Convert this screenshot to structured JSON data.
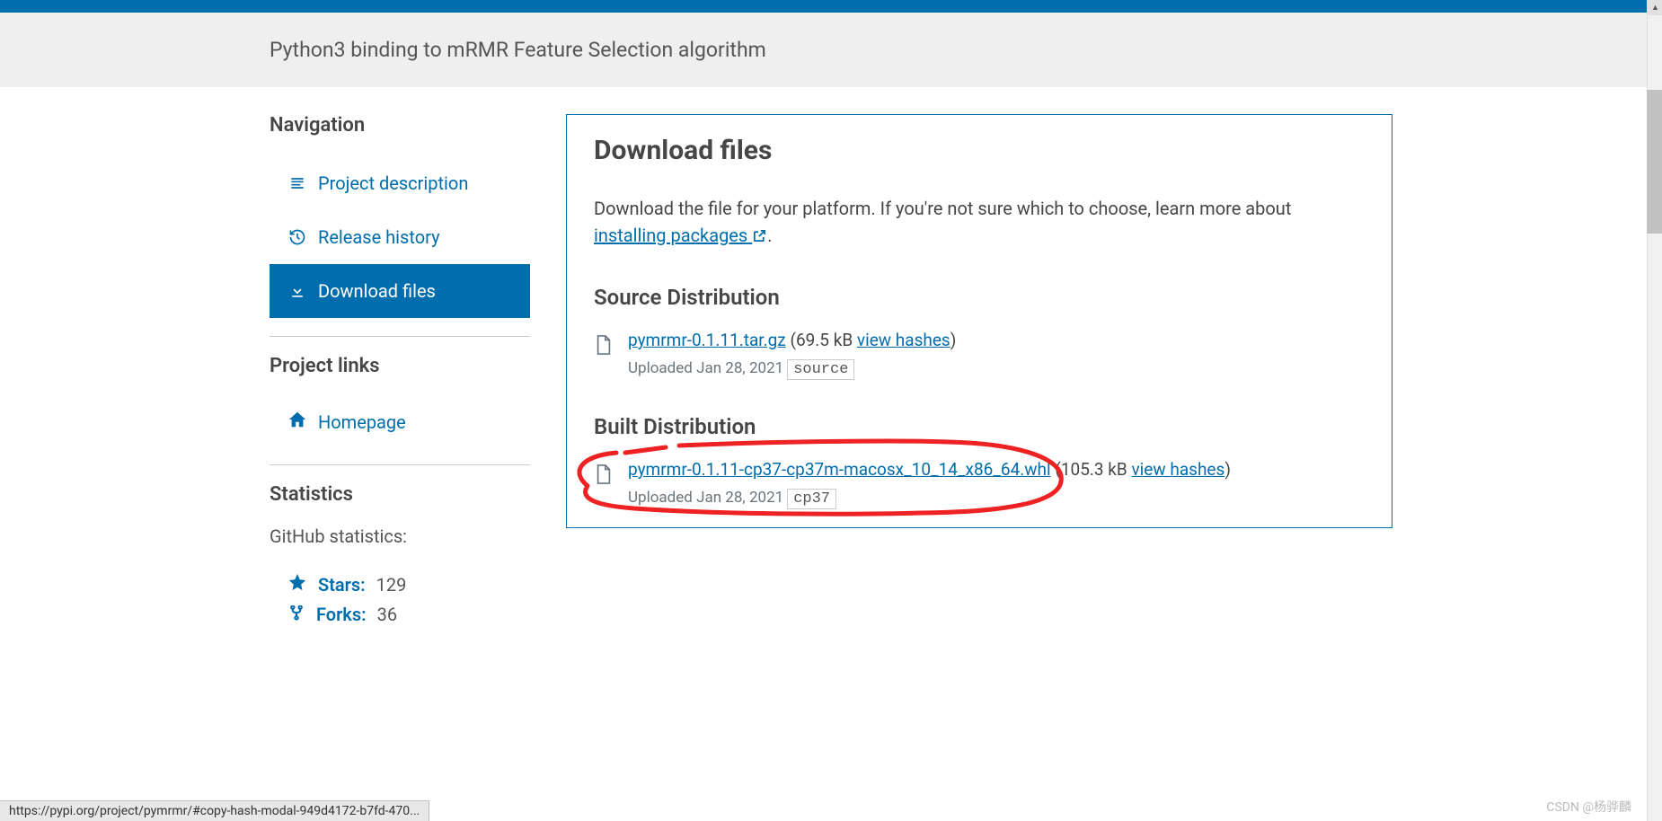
{
  "summary": "Python3 binding to mRMR Feature Selection algorithm",
  "navigation": {
    "heading": "Navigation",
    "items": [
      {
        "label": "Project description"
      },
      {
        "label": "Release history"
      },
      {
        "label": "Download files"
      }
    ]
  },
  "project_links": {
    "heading": "Project links",
    "items": [
      {
        "label": "Homepage"
      }
    ]
  },
  "statistics": {
    "heading": "Statistics",
    "subheading": "GitHub statistics:",
    "stars_label": "Stars:",
    "stars_value": "129",
    "forks_label": "Forks:",
    "forks_value": "36"
  },
  "content": {
    "heading": "Download files",
    "intro_prefix": "Download the file for your platform. If you're not sure which to choose, learn more about ",
    "intro_link": "installing packages",
    "intro_suffix": ".",
    "source_heading": "Source Distribution",
    "built_heading": "Built Distribution",
    "source_file": {
      "name": "pymrmr-0.1.11.tar.gz",
      "size": "(69.5 kB ",
      "hashes": "view hashes",
      "close": ")",
      "uploaded_prefix": "Uploaded ",
      "uploaded_date": "Jan 28, 2021",
      "tag": "source"
    },
    "built_file": {
      "name": "pymrmr-0.1.11-cp37-cp37m-macosx_10_14_x86_64.whl",
      "size": "(105.3 kB ",
      "hashes": "view hashes",
      "close": ")",
      "uploaded_prefix": "Uploaded ",
      "uploaded_date": "Jan 28, 2021",
      "tag": "cp37"
    }
  },
  "status_url": "https://pypi.org/project/pymrmr/#copy-hash-modal-949d4172-b7fd-470...",
  "watermark": "CSDN @杨骅麟"
}
